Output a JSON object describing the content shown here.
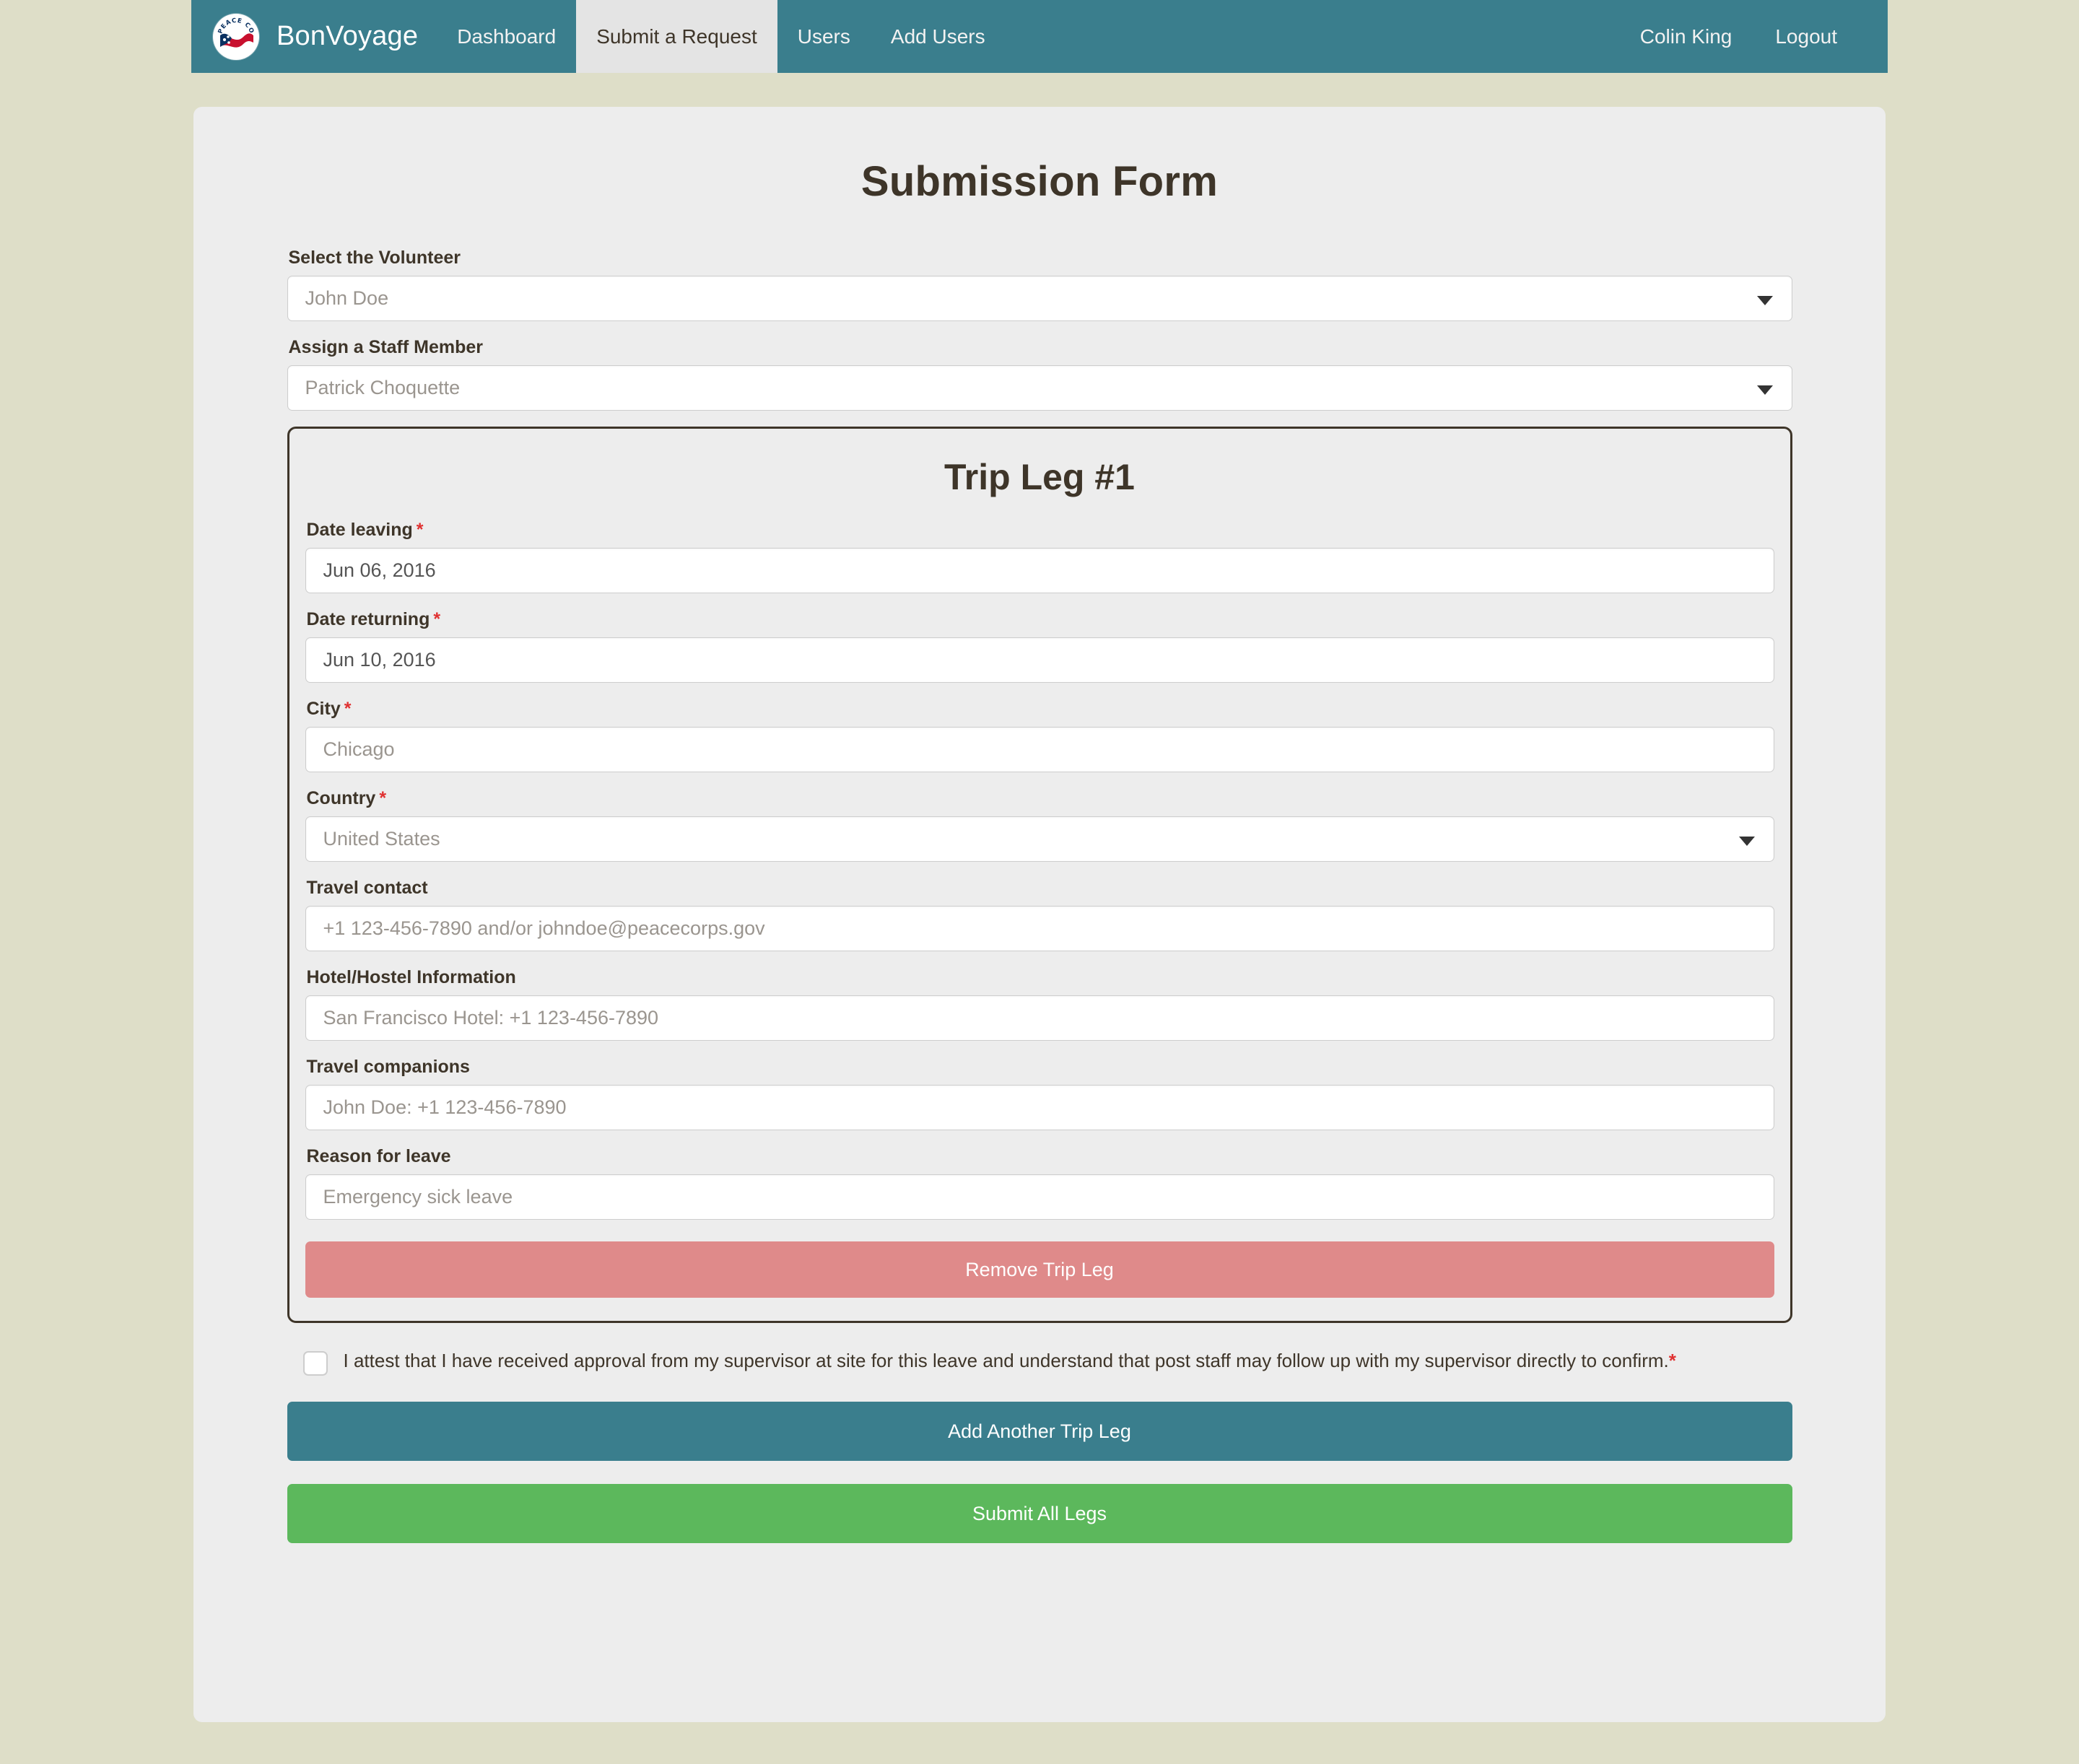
{
  "navbar": {
    "logo_icon": "peace-corps-logo-icon",
    "brand": "BonVoyage",
    "items": [
      {
        "label": "Dashboard",
        "active": false
      },
      {
        "label": "Submit a Request",
        "active": true
      },
      {
        "label": "Users",
        "active": false
      },
      {
        "label": "Add Users",
        "active": false
      }
    ],
    "user": "Colin King",
    "logout": "Logout",
    "background_color": "#3a7e8d",
    "active_tab_color": "#e4e4e4"
  },
  "form": {
    "title": "Submission Form",
    "volunteer": {
      "label": "Select the Volunteer",
      "value": "John Doe",
      "is_placeholder": true
    },
    "staff": {
      "label": "Assign a Staff Member",
      "value": "Patrick Choquette",
      "is_placeholder": true
    }
  },
  "trip_leg": {
    "title": "Trip Leg #1",
    "required_marker": "*",
    "fields": [
      {
        "label": "Date leaving",
        "required": true,
        "value": "Jun 06, 2016",
        "type": "date",
        "filled": true
      },
      {
        "label": "Date returning",
        "required": true,
        "value": "Jun 10, 2016",
        "type": "date",
        "filled": true
      },
      {
        "label": "City",
        "required": true,
        "value": "Chicago",
        "type": "text",
        "filled": false
      },
      {
        "label": "Country",
        "required": true,
        "value": "United States",
        "type": "select",
        "filled": false
      },
      {
        "label": "Travel contact",
        "required": false,
        "value": "+1 123-456-7890  and/or  johndoe@peacecorps.gov",
        "type": "text",
        "filled": false
      },
      {
        "label": "Hotel/Hostel Information",
        "required": false,
        "value": "San Francisco Hotel: +1 123-456-7890",
        "type": "text",
        "filled": false
      },
      {
        "label": "Travel companions",
        "required": false,
        "value": "John Doe: +1 123-456-7890",
        "type": "text",
        "filled": false
      },
      {
        "label": "Reason for leave",
        "required": false,
        "value": "Emergency sick leave",
        "type": "text",
        "filled": false
      }
    ],
    "remove_button": "Remove Trip Leg",
    "remove_button_color": "#df8a8a"
  },
  "attestation": {
    "checked": false,
    "text": "I attest that I have received approval from my supervisor at site for this leave and understand that post staff may follow up with my supervisor directly to confirm.",
    "required_marker": "*"
  },
  "actions": {
    "add_leg": "Add Another Trip Leg",
    "add_leg_color": "#3a7e8d",
    "submit": "Submit All Legs",
    "submit_color": "#5cb85c"
  }
}
